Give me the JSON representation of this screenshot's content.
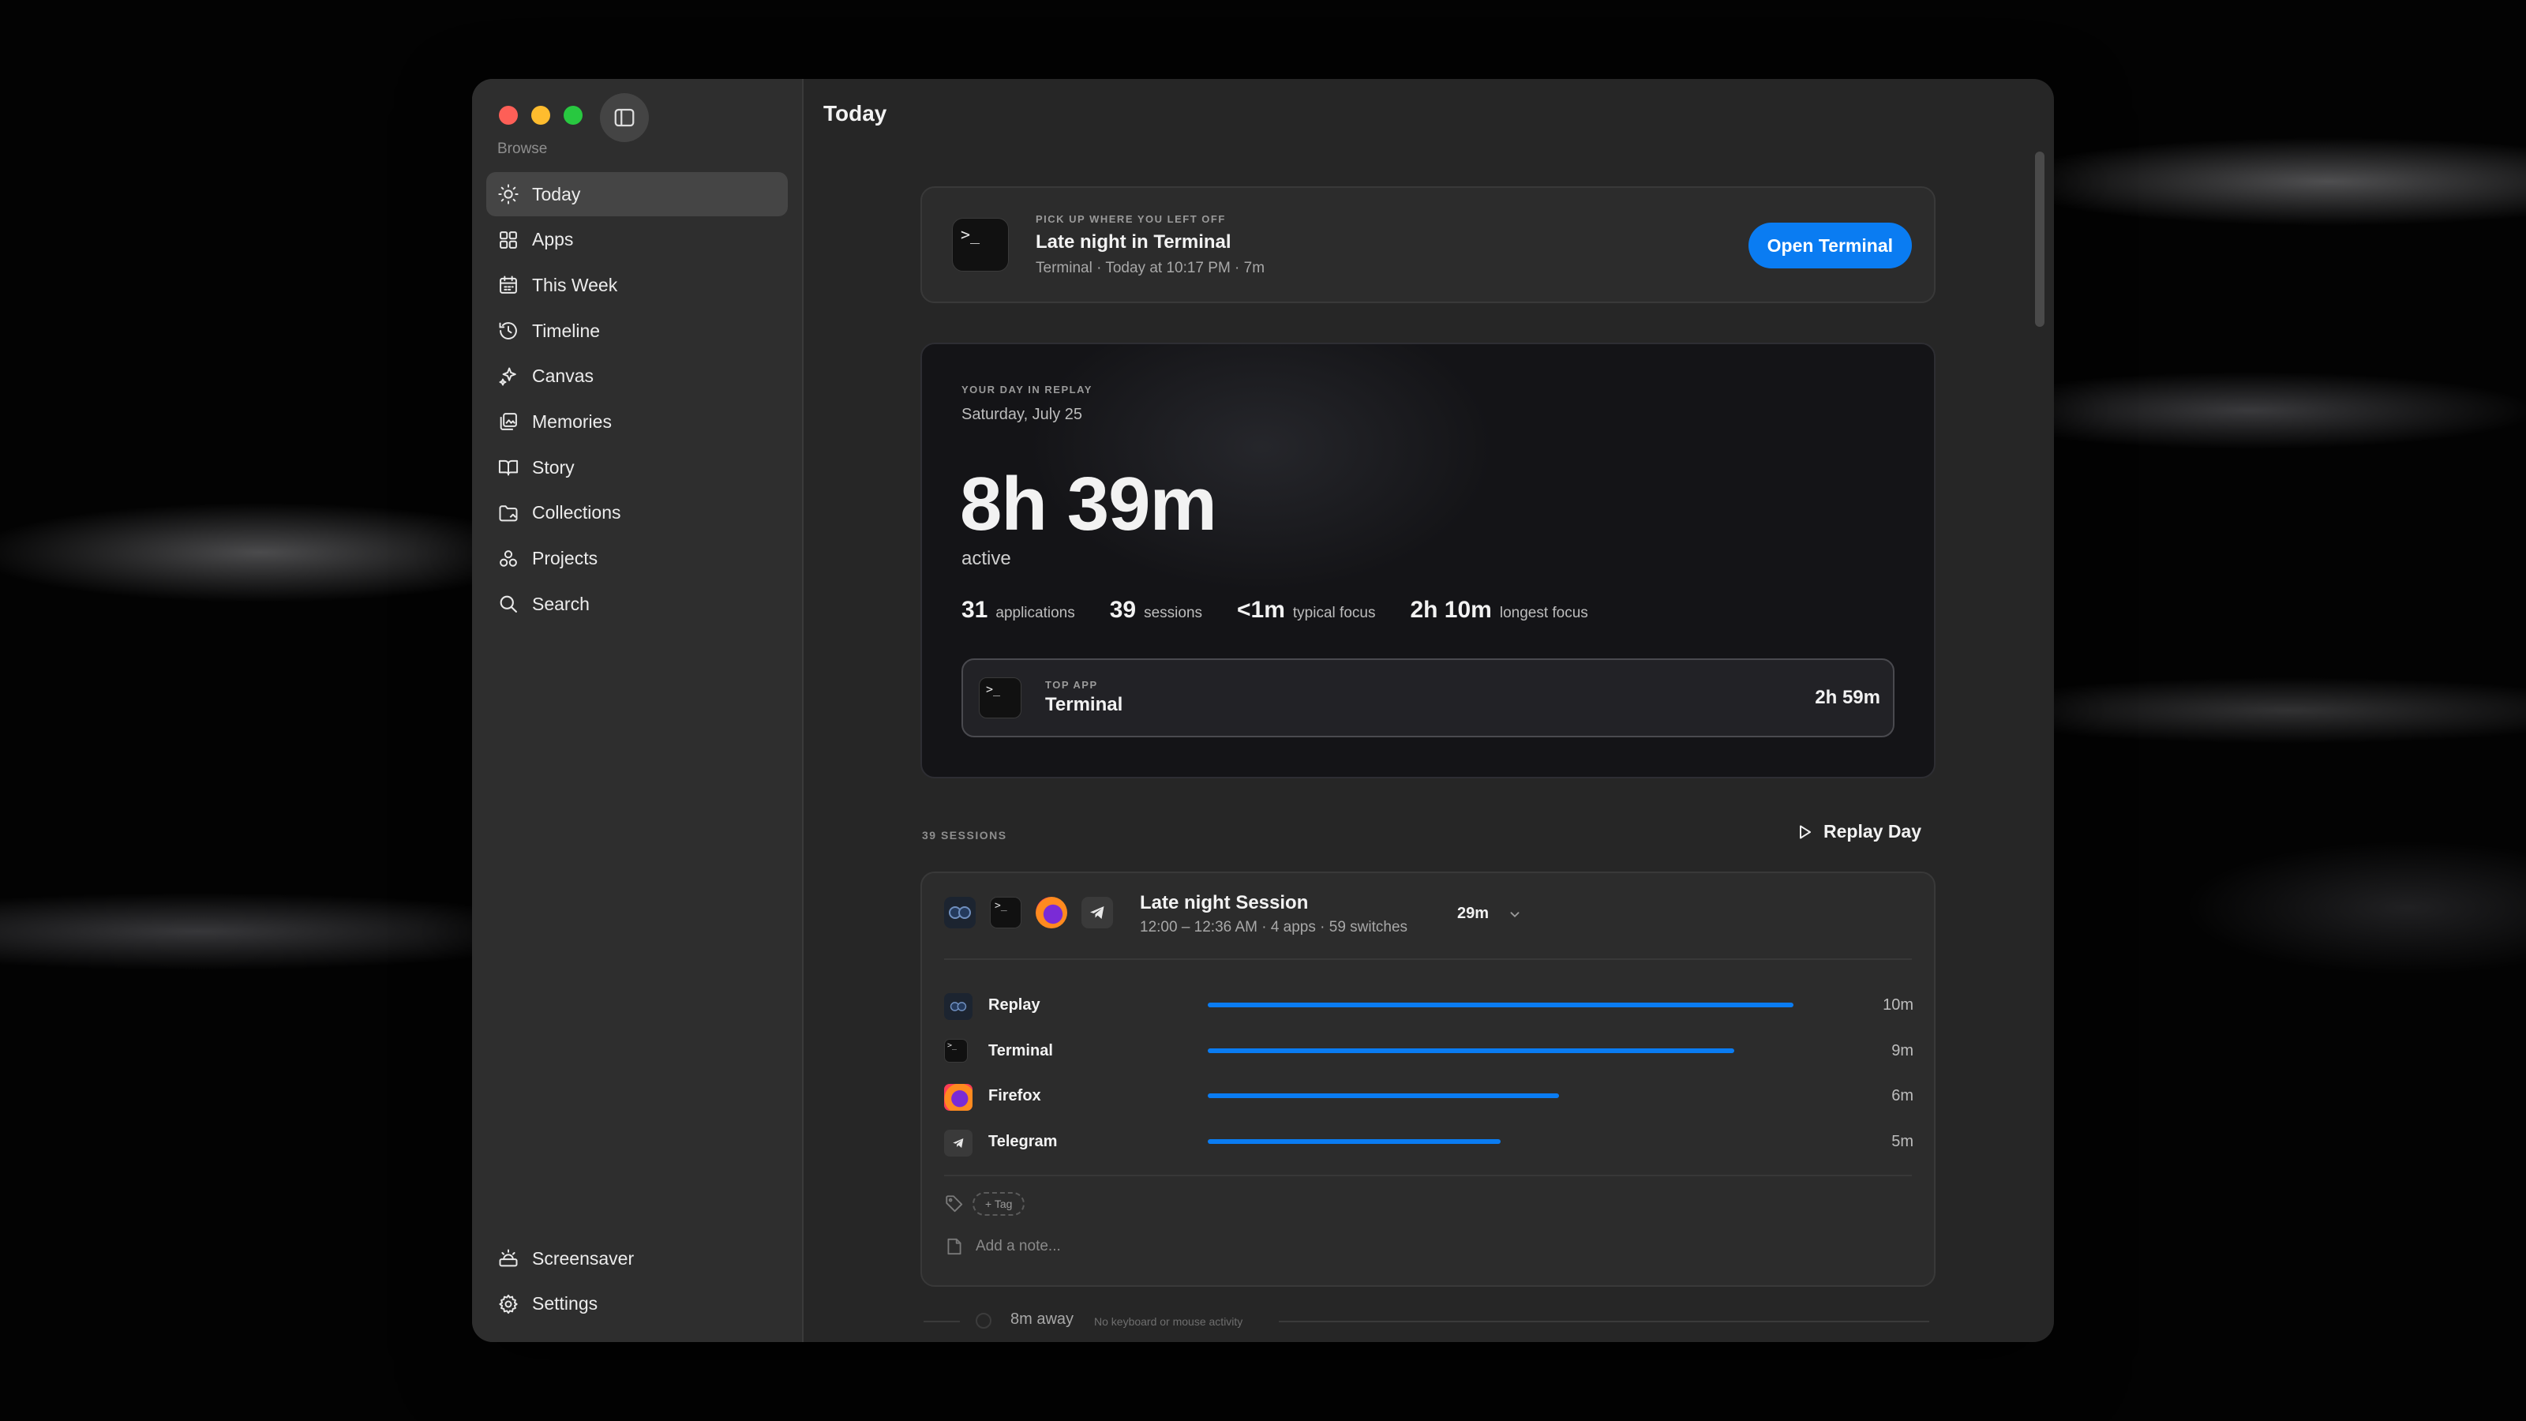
{
  "sidebar": {
    "section_label": "Browse",
    "items": [
      {
        "label": "Today",
        "icon": "sun-icon",
        "active": true
      },
      {
        "label": "Apps",
        "icon": "grid-icon"
      },
      {
        "label": "This Week",
        "icon": "calendar-icon"
      },
      {
        "label": "Timeline",
        "icon": "history-icon"
      },
      {
        "label": "Canvas",
        "icon": "sparkles-icon"
      },
      {
        "label": "Memories",
        "icon": "photos-icon"
      },
      {
        "label": "Story",
        "icon": "book-icon"
      },
      {
        "label": "Collections",
        "icon": "folder-icon"
      },
      {
        "label": "Projects",
        "icon": "shapes-icon"
      },
      {
        "label": "Search",
        "icon": "search-icon"
      }
    ],
    "bottom_items": [
      {
        "label": "Screensaver",
        "icon": "screensaver-icon"
      },
      {
        "label": "Settings",
        "icon": "gear-icon"
      }
    ]
  },
  "main": {
    "title": "Today",
    "resume": {
      "eyebrow": "PICK UP WHERE YOU LEFT OFF",
      "title": "Late night in Terminal",
      "meta": "Terminal · Today at 10:17 PM · 7m",
      "button": "Open Terminal"
    },
    "replay": {
      "eyebrow": "YOUR DAY IN REPLAY",
      "date": "Saturday, July 25",
      "total": "8h 39m",
      "total_label": "active",
      "stats": [
        {
          "value": "31",
          "label": "applications"
        },
        {
          "value": "39",
          "label": "sessions"
        },
        {
          "value": "<1m",
          "label": "typical focus"
        },
        {
          "value": "2h 10m",
          "label": "longest focus"
        }
      ],
      "top_app": {
        "eyebrow": "TOP APP",
        "name": "Terminal",
        "time": "2h 59m"
      }
    },
    "sessions_label": "39 SESSIONS",
    "replay_day_label": "Replay Day",
    "session": {
      "title": "Late night Session",
      "meta": "12:00 – 12:36 AM · 4 apps · 59 switches",
      "duration": "29m",
      "apps": [
        {
          "name": "Replay",
          "time": "10m",
          "minutes": 10
        },
        {
          "name": "Terminal",
          "time": "9m",
          "minutes": 9
        },
        {
          "name": "Firefox",
          "time": "6m",
          "minutes": 6
        },
        {
          "name": "Telegram",
          "time": "5m",
          "minutes": 5
        }
      ],
      "tag_label": "+ Tag",
      "note_placeholder": "Add a note..."
    },
    "away": {
      "label": "8m away",
      "sublabel": "No keyboard or mouse activity"
    }
  },
  "colors": {
    "accent": "#0a7cf2",
    "traffic_red": "#fe5f57",
    "traffic_yellow": "#febc2e",
    "traffic_green": "#28c840"
  }
}
